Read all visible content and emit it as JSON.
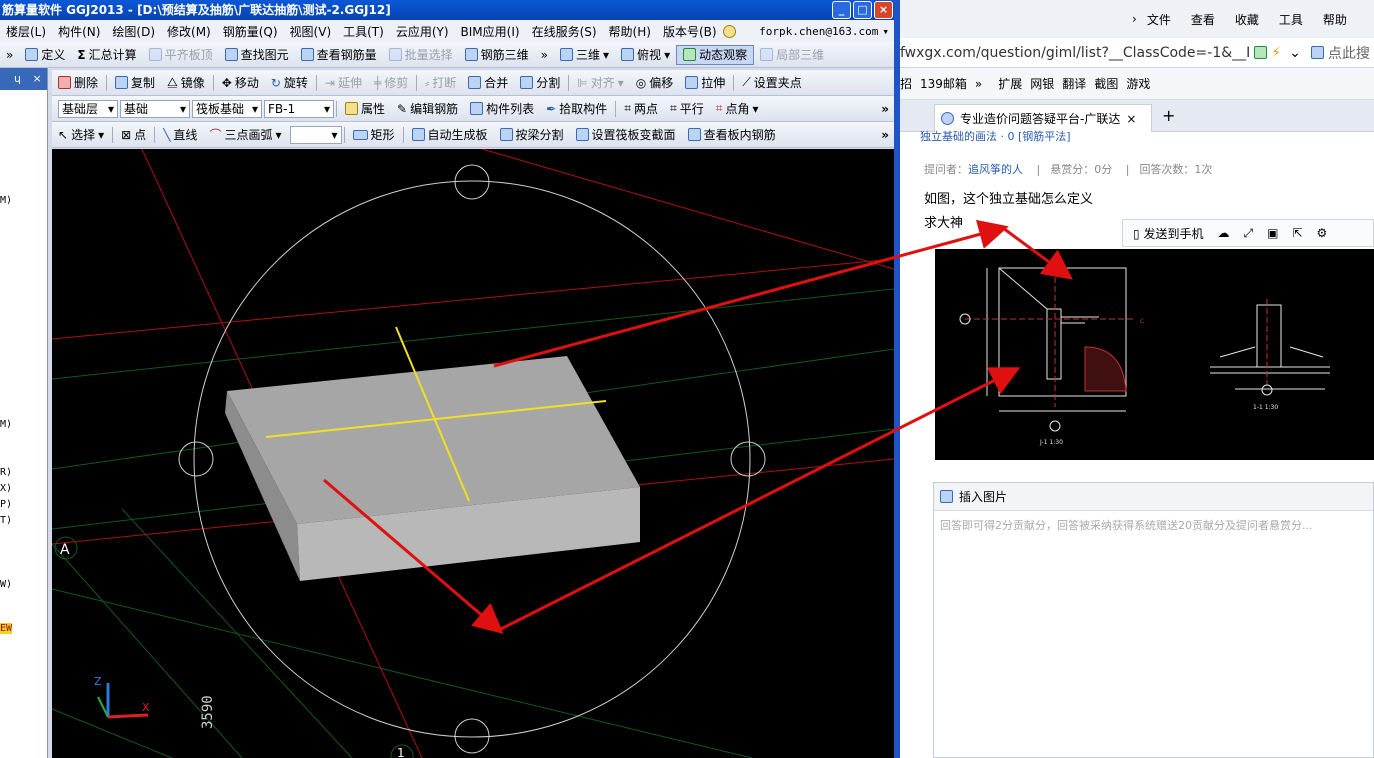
{
  "window": {
    "title": "筋算量软件 GGJ2013 - [D:\\预结算及抽筋\\广联达抽筋\\测试-2.GGJ12]",
    "min_glyph": "_",
    "max_glyph": "□",
    "close_glyph": "×"
  },
  "menu": {
    "items": [
      "楼层(L)",
      "构件(N)",
      "绘图(D)",
      "修改(M)",
      "钢筋量(Q)",
      "视图(V)",
      "工具(T)",
      "云应用(Y)",
      "BIM应用(I)",
      "在线服务(S)",
      "帮助(H)",
      "版本号(B)"
    ],
    "account": "forpk.chen@163.com",
    "account_arrow": "▾"
  },
  "toolbar1": {
    "lead": "»",
    "define": "定义",
    "sum": "汇总计算",
    "flat_top": "平齐板顶",
    "find_element": "查找图元",
    "view_rebar": "查看钢筋量",
    "batch_select": "批量选择",
    "rebar_3d": "钢筋三维",
    "more": "»",
    "view_3d": "三维",
    "top_view": "俯视",
    "dynamic_observe": "动态观察",
    "local_3d": "局部三维"
  },
  "toolbar2": {
    "delete": "删除",
    "copy": "复制",
    "mirror": "镜像",
    "move": "移动",
    "rotate": "旋转",
    "extend": "延伸",
    "trim": "修剪",
    "break": "打断",
    "merge": "合并",
    "split": "分割",
    "align": "对齐",
    "offset": "偏移",
    "stretch": "拉伸",
    "set_grip": "设置夹点"
  },
  "toolbar3": {
    "layer": "基础层",
    "category": "基础",
    "type": "筏板基础",
    "name": "FB-1",
    "properties": "属性",
    "edit_rebar": "编辑钢筋",
    "element_list": "构件列表",
    "pick_element": "拾取构件",
    "two_points": "两点",
    "parallel": "平行",
    "point_angle": "点角",
    "more": "»"
  },
  "toolbar4": {
    "select": "选择",
    "point": "点",
    "line": "直线",
    "arc": "三点画弧",
    "rect": "矩形",
    "auto_slab": "自动生成板",
    "split_by_beam": "按梁分割",
    "set_slope": "设置筏板变截面",
    "view_slab_rebar": "查看板内钢筋",
    "more": "»"
  },
  "left_panel": {
    "pin": "ɥ",
    "close": "×",
    "items": [
      "M)",
      "M)",
      "R)",
      "X)",
      "P)",
      "T)",
      "W)",
      "EW"
    ]
  },
  "viewport": {
    "axis_label_a": "A",
    "axis_label_1": "1",
    "dimension": "3590",
    "axis_z": "Z",
    "axis_x": "X"
  },
  "browser": {
    "menu": [
      "文件",
      "查看",
      "收藏",
      "工具",
      "帮助"
    ],
    "url": "fwxgx.com/question/giml/list?__ClassCode=-1&__I",
    "address_search": "点此搜",
    "links": [
      "招",
      "139邮箱",
      "扩展",
      "网银",
      "翻译",
      "截图",
      "游戏"
    ],
    "tab_title": "专业造价问题答疑平台-广联达",
    "tab_close": "×",
    "new_tab": "+",
    "breadcrumb": "独立基础的画法 · 0 [钢筋平法]",
    "asker_label": "提问者：",
    "asker": "追风筝的人",
    "reward": "悬赏分：0分",
    "answers": "回答次数：1次",
    "question_line1": "如图，这个独立基础怎么定义",
    "question_line2": "求大神",
    "send_to_phone": "发送到手机",
    "insert_image": "插入图片",
    "answer_placeholder": "回答即可得2分贡献分，回答被采纳获得系统赠送20贡献分及提问者悬赏分..."
  },
  "cad": {
    "label_left": "J-1 1:30",
    "label_right": "1-1 1:30",
    "axis_c": "C"
  },
  "colors": {
    "title_bar": "#0a50c8",
    "toolbar_bg": "#dde2ee",
    "viewport_bg": "#000000",
    "slab": "#a4a4a4",
    "grid_red": "#b01010",
    "grid_green": "#0e5a1a",
    "axis_yellow": "#f0e020",
    "arrow": "#e01010"
  }
}
